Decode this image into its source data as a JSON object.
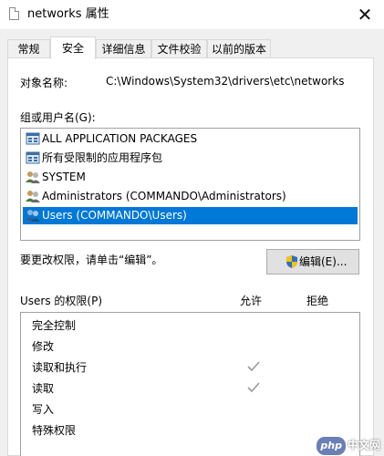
{
  "window": {
    "title": "networks 属性",
    "close_label": "✕"
  },
  "tabs": [
    {
      "label": "常规"
    },
    {
      "label": "安全"
    },
    {
      "label": "详细信息"
    },
    {
      "label": "文件校验"
    },
    {
      "label": "以前的版本"
    }
  ],
  "object": {
    "label": "对象名称:",
    "value": "C:\\Windows\\System32\\drivers\\etc\\networks"
  },
  "groups": {
    "label": "组或用户名(G):",
    "items": [
      {
        "label": "ALL APPLICATION PACKAGES",
        "icon": "app-packages-icon"
      },
      {
        "label": "所有受限制的应用程序包",
        "icon": "app-packages-icon"
      },
      {
        "label": "SYSTEM",
        "icon": "users-icon"
      },
      {
        "label": "Administrators (COMMANDO\\Administrators)",
        "icon": "users-icon"
      },
      {
        "label": "Users (COMMANDO\\Users)",
        "icon": "users-icon",
        "selected": true
      }
    ]
  },
  "change_hint": "要更改权限，请单击“编辑”。",
  "edit_button": {
    "label": "编辑(E)...",
    "icon": "uac-shield-icon"
  },
  "permissions": {
    "label": "Users 的权限(P)",
    "allow_header": "允许",
    "deny_header": "拒绝",
    "rows": [
      {
        "label": "完全控制",
        "allow": false,
        "deny": false
      },
      {
        "label": "修改",
        "allow": false,
        "deny": false
      },
      {
        "label": "读取和执行",
        "allow": true,
        "deny": false
      },
      {
        "label": "读取",
        "allow": true,
        "deny": false
      },
      {
        "label": "写入",
        "allow": false,
        "deny": false
      },
      {
        "label": "特殊权限",
        "allow": false,
        "deny": false
      }
    ]
  },
  "watermark": {
    "badge": "php",
    "text": "中文网"
  },
  "colors": {
    "selection": "#0078d7",
    "check_gray": "#9a9a9a",
    "window_bg": "#f0f0f0"
  }
}
